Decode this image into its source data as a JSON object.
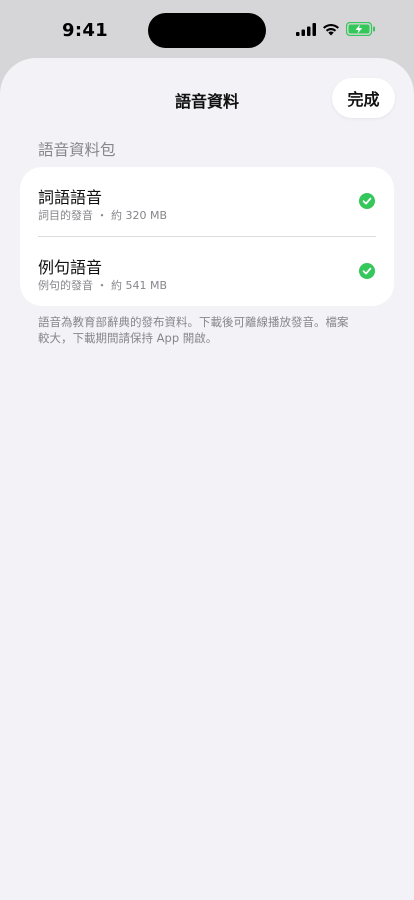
{
  "status_bar": {
    "time": "9:41"
  },
  "sheet": {
    "title": "語音資料",
    "done_label": "完成",
    "section_header": "語音資料包",
    "items": [
      {
        "title": "詞語語音",
        "subtitle": "詞目的發音 ・ 約 320 MB",
        "status": "downloaded"
      },
      {
        "title": "例句語音",
        "subtitle": "例句的發音 ・ 約 541 MB",
        "status": "downloaded"
      }
    ],
    "footer": "語音為教育部辭典的發布資料。下載後可離線播放發音。檔案\n較大，下載期間請保持 App 開啟。"
  },
  "colors": {
    "accent_green": "#34c759",
    "sheet_background": "#f2f2f7",
    "secondary_text": "#86868b"
  }
}
